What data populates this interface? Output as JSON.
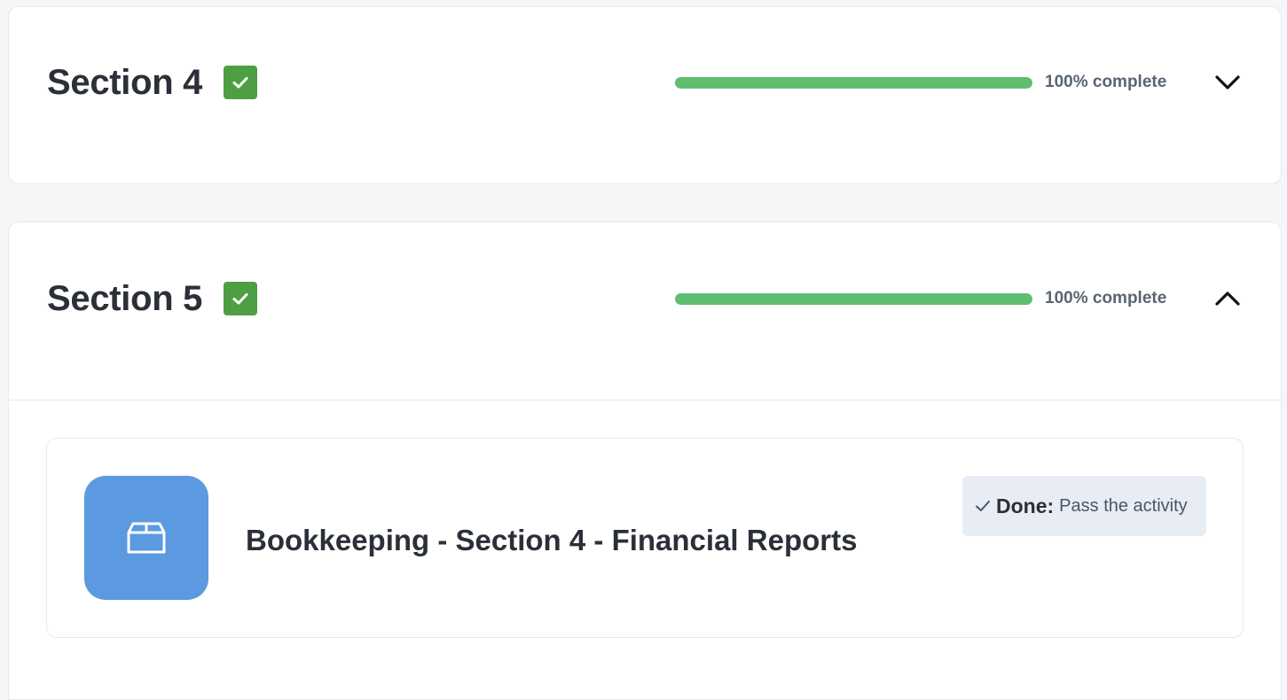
{
  "sections": [
    {
      "title": "Section 4",
      "progress_fraction": 1.0,
      "progress_text": "100% complete",
      "expanded": false,
      "toggle_icon": "chevron-down-icon"
    },
    {
      "title": "Section 5",
      "progress_fraction": 1.0,
      "progress_text": "100% complete",
      "expanded": true,
      "toggle_icon": "chevron-up-icon",
      "activities": [
        {
          "title": "Bookkeeping - Section 4 - Financial Reports",
          "icon": "package-icon",
          "completion": {
            "label": "Done:",
            "description": "Pass the activity"
          }
        }
      ]
    }
  ],
  "colors": {
    "check_badge": "#4e9f44",
    "progress_fill": "#5fbe6f",
    "activity_icon_bg": "#5b9ae0",
    "completion_badge_bg": "#e8edf5"
  }
}
